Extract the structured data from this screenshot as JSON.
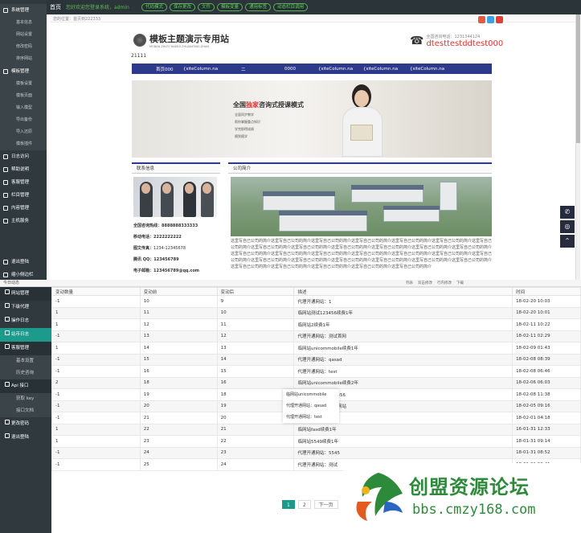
{
  "topbar": {
    "home": "首页",
    "welcome": "您好欢迎您登录系统，admin",
    "buttons": [
      "代码模式",
      "保存更改",
      "文件",
      "模板变量",
      "通用标签",
      "动态栏目调用"
    ]
  },
  "sideA": {
    "sections": [
      {
        "label": "系统管理",
        "items": [
          "基本信息",
          "网站设置",
          "修改密码",
          "排序网站"
        ]
      },
      {
        "label": "模板管理",
        "items": [
          "模板设置",
          "模板页面",
          "输入模型",
          "导出备份",
          "导入还原",
          "模板插件"
        ]
      },
      {
        "label": "日志访问",
        "items": []
      },
      {
        "label": "帮助说明",
        "items": []
      },
      {
        "label": "客服管理",
        "items": []
      },
      {
        "label": "栏目管理",
        "items": []
      },
      {
        "label": "内容管理",
        "items": []
      },
      {
        "label": "主机服务",
        "items": []
      }
    ],
    "bottom": [
      "退出登陆",
      "缩小侧边栏"
    ]
  },
  "preview": {
    "crumb": "您的位置：首页到222333",
    "logo_title": "模板主题演示专用站",
    "logo_sub": "MOBAN ZHUTI YANSHI ZHUANYONG ZHAN",
    "phone_small": "全国咨询电话：1231344124",
    "phone_big": "dtesttestddtest000",
    "site_text": "21111",
    "nav": [
      "首页000",
      "{siteColumn.na",
      "二",
      "0000",
      "{siteColumn.na",
      "{siteColumn.na",
      "{siteColumn.na"
    ],
    "banner_title_a": "全国",
    "banner_title_b": "独家",
    "banner_title_c": "咨询式授课模式",
    "banner_lines": [
      "全面同步教学",
      "帮你掌握重点知识",
      "学完即得成绩",
      "随到随学"
    ],
    "contact_head": "联系信息",
    "company_head": "公司简介",
    "contacts": [
      {
        "k": "全国咨询热线：",
        "v": "8888888333333",
        "bold": true
      },
      {
        "k": "移动电话：",
        "v": "2222222222",
        "bold": true
      },
      {
        "k": "图文传真：",
        "v": "1234-12345678",
        "bold": false
      },
      {
        "k": "腾讯 QQ：",
        "v": "123456789",
        "bold": true
      },
      {
        "k": "电子邮箱：",
        "v": "123456789@qq.com",
        "bold": true
      }
    ],
    "company_text": "这里写自己公司的简介这里写自己公司的简介这里写自己公司的简介这里写自己公司的简介这里写自己公司的简介这里写自己公司的简介这里写自己公司的简介这里写自己公司的简介这里写自己公司的简介这里写自己公司的简介这里写自己公司的简介这里写自己公司的简介这里写自己公司的简介这里写自己公司的简介这里写自己公司的简介这里写自己公司的简介这里写自己公司的简介这里写自己公司的简介这里写自己公司的简介这里写自己公司的简介这里写自己公司的简介这里写自己公司的简介这里写自己公司的简介这里写自己公司的简介这里写自己公司的简介这里写自己公司的简介这里写自己公司的简介这里写自己公司的简介这里写自己公司的简介这里写自己公司的简介这里写自己公司的简介"
  },
  "window": {
    "title": "今日动态"
  },
  "toolbar": [
    "列表",
    "双击修改",
    "行内修改",
    "下载"
  ],
  "sideB": {
    "sections": [
      {
        "label": "网站管理",
        "items": [],
        "style": "dk"
      },
      {
        "label": "下级代理",
        "items": [],
        "style": ""
      },
      {
        "label": "操作日志",
        "items": [],
        "style": ""
      },
      {
        "label": "站币日志",
        "items": [],
        "style": "hl"
      },
      {
        "label": "客服管理",
        "items": [
          "基本设置",
          "历史咨询"
        ],
        "style": "dk"
      },
      {
        "label": "Api 接口",
        "items": [
          "获取 key",
          "接口文档"
        ],
        "style": "dk"
      },
      {
        "label": "更改密码",
        "items": [],
        "style": ""
      },
      {
        "label": "退出登陆",
        "items": [],
        "style": ""
      }
    ]
  },
  "table": {
    "headers": [
      "变动数量",
      "变动前",
      "变动后",
      "描述",
      "时间"
    ],
    "rows": [
      [
        "-1",
        "10",
        "9",
        "代理开通网站：1",
        "18-02-20 10:03"
      ],
      [
        "1",
        "11",
        "10",
        "临网站测试123456续费1年",
        "18-02-20 10:01"
      ],
      [
        "1",
        "12",
        "11",
        "临网站2续费1年",
        "18-02-11 10:22"
      ],
      [
        "-1",
        "13",
        "12",
        "代理开通网站：测试首网",
        "18-02-11 02:29"
      ],
      [
        "1",
        "14",
        "13",
        "临网站unicommobile续费1年",
        "18-02-09 01:43"
      ],
      [
        "-1",
        "15",
        "14",
        "代理开通网站：qasad",
        "18-02-08 08:39"
      ],
      [
        "-1",
        "16",
        "15",
        "代理开通网站：test",
        "18-02-08 06:46"
      ],
      [
        "2",
        "18",
        "16",
        "临网站unicommobile续费2年",
        "18-02-06 06:03"
      ],
      [
        "-1",
        "19",
        "18",
        "代理开通网站：123456",
        "18-02-08 11:38"
      ],
      [
        "-1",
        "20",
        "19",
        "代理开通网站：测试网站",
        "18-02-05 09:16"
      ],
      [
        "-1",
        "21",
        "20",
        "代理开通网站：测试",
        "18-02-01 04:18"
      ],
      [
        "1",
        "22",
        "21",
        "临网站fasd续费1年",
        "16-01-31 12:33"
      ],
      [
        "1",
        "23",
        "22",
        "临网站5549续费1年",
        "18-01-31 09:14"
      ],
      [
        "-1",
        "24",
        "23",
        "代理开通网站：5545",
        "18-01-31 08:52"
      ],
      [
        "-1",
        "25",
        "24",
        "代理开通网站：测试",
        "18-01-31 08:41"
      ]
    ]
  },
  "popup": [
    "临网站unicommobile",
    "代理开通网站：qasad",
    "代理开通网站：test"
  ],
  "pager": [
    "1",
    "2",
    "下一页"
  ],
  "watermark": {
    "title": "创盟资源论坛",
    "url": "bbs.cmzy168.com"
  }
}
